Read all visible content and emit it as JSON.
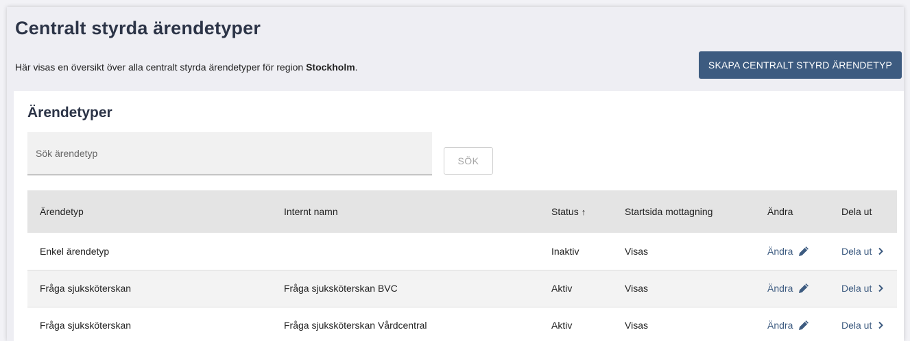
{
  "page": {
    "title": "Centralt styrda ärendetyper",
    "intro_prefix": "Här visas en översikt över alla centralt styrda ärendetyper för region ",
    "intro_region": "Stockholm",
    "intro_suffix": ".",
    "create_button": "SKAPA CENTRALT STYRD ÄRENDETYP"
  },
  "card": {
    "title": "Ärendetyper",
    "search_placeholder": "Sök ärendetyp",
    "search_button": "SÖK"
  },
  "table": {
    "headers": {
      "arendetyp": "Ärendetyp",
      "internt_namn": "Internt namn",
      "status": "Status",
      "status_sort": "↑",
      "startsida": "Startsida mottagning",
      "andra": "Ändra",
      "dela_ut": "Dela ut"
    },
    "rows": [
      {
        "arendetyp": "Enkel ärendetyp",
        "internt_namn": "",
        "status": "Inaktiv",
        "startsida": "Visas",
        "andra": "Ändra",
        "dela_ut": "Dela ut"
      },
      {
        "arendetyp": "Fråga sjuksköterskan",
        "internt_namn": "Fråga sjuksköterskan BVC",
        "status": "Aktiv",
        "startsida": "Visas",
        "andra": "Ändra",
        "dela_ut": "Dela ut"
      },
      {
        "arendetyp": "Fråga sjuksköterskan",
        "internt_namn": "Fråga sjuksköterskan Vårdcentral",
        "status": "Aktiv",
        "startsida": "Visas",
        "andra": "Ändra",
        "dela_ut": "Dela ut"
      }
    ]
  },
  "colors": {
    "primary": "#3d5b80",
    "title": "#2c3447"
  },
  "icons": {
    "edit": "pencil-icon",
    "share": "chevron-right-icon"
  }
}
